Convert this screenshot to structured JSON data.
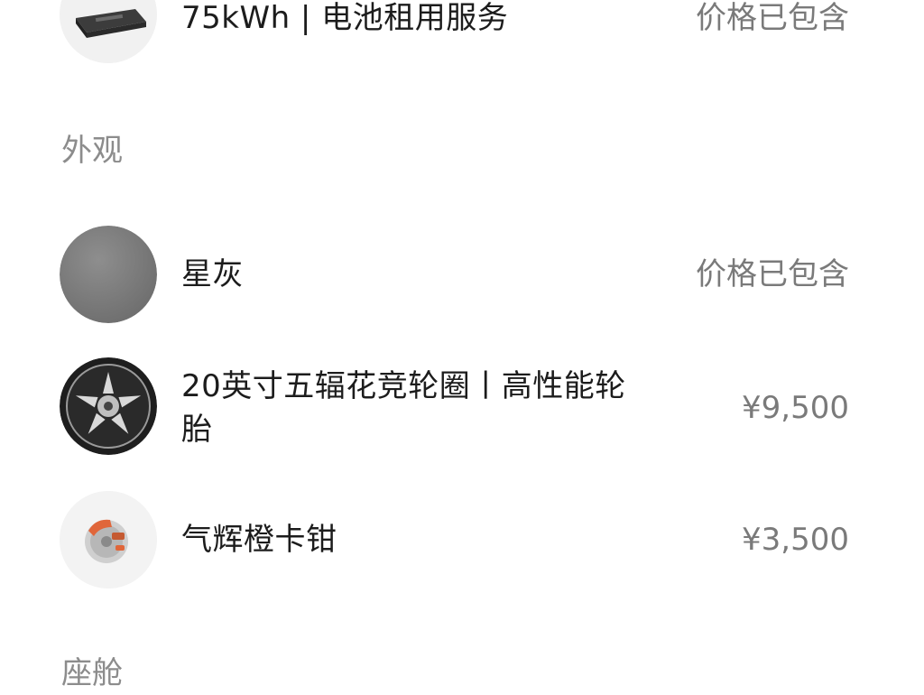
{
  "items": [
    {
      "label": "75kWh | 电池租用服务",
      "value": "价格已包含",
      "icon": "battery-pack-icon"
    },
    {
      "label": "星灰",
      "value": "价格已包含",
      "icon": "star-grey-color-swatch-icon",
      "color": "#7e7e7e"
    },
    {
      "label_line1": "20英寸五辐花竞轮圈丨高性能轮",
      "label_line2": "胎",
      "value": "¥9,500",
      "icon": "wheel-rim-icon"
    },
    {
      "label": "气辉橙卡钳",
      "value": "¥3,500",
      "icon": "brake-caliper-icon",
      "color": "#e0663a"
    }
  ],
  "sections": {
    "exterior": "外观",
    "cabin": "座舱"
  }
}
